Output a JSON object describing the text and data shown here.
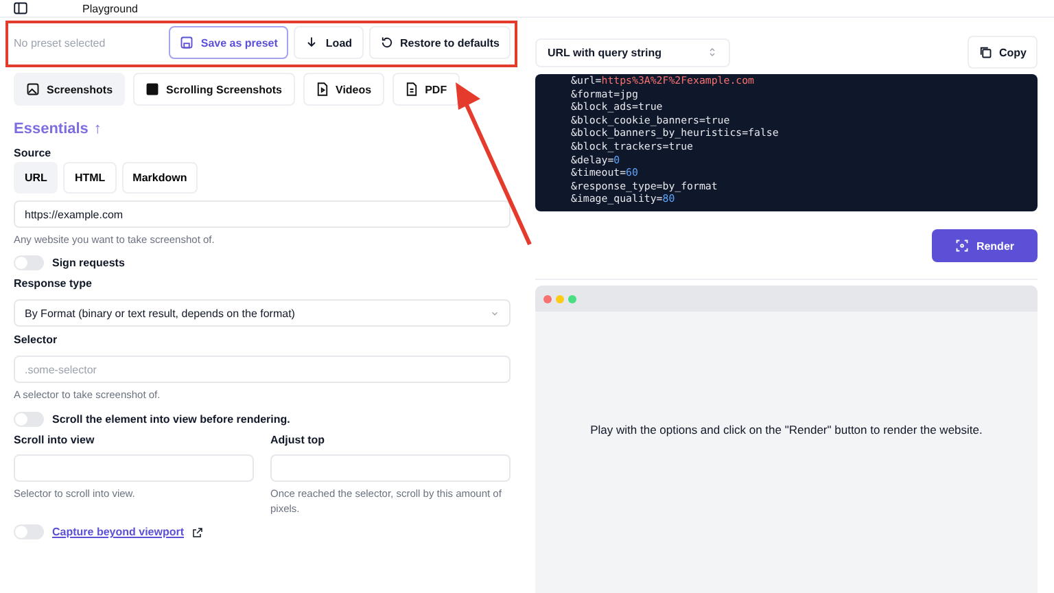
{
  "header": {
    "title": "Playground"
  },
  "preset_bar": {
    "status": "No preset selected",
    "buttons": [
      {
        "label": "Save as preset",
        "kind": "primary"
      },
      {
        "label": "Load",
        "kind": "plain"
      },
      {
        "label": "Restore to defaults",
        "kind": "plain"
      }
    ]
  },
  "tabs": [
    {
      "label": "Screenshots",
      "selected": true
    },
    {
      "label": "Scrolling Screenshots",
      "selected": false
    },
    {
      "label": "Videos",
      "selected": false
    },
    {
      "label": "PDF",
      "selected": false
    }
  ],
  "section": {
    "title": "Essentials",
    "toggle": "↑"
  },
  "source": {
    "label": "Source",
    "options": [
      {
        "label": "URL",
        "selected": true
      },
      {
        "label": "HTML",
        "selected": false
      },
      {
        "label": "Markdown",
        "selected": false
      }
    ],
    "value": "https://example.com",
    "hint": "Any website you want to take screenshot of."
  },
  "sign_requests": {
    "label": "Sign requests",
    "on": false
  },
  "response_type": {
    "label": "Response type",
    "value": "By Format (binary or text result, depends on the format)"
  },
  "selector": {
    "label": "Selector",
    "placeholder": ".some-selector",
    "hint": "A selector to take screenshot of."
  },
  "scroll_toggle": {
    "label": "Scroll the element into view before rendering.",
    "on": false
  },
  "scroll_fields": [
    {
      "label": "Scroll into view",
      "hint": "Selector to scroll into view."
    },
    {
      "label": "Adjust top",
      "hint": "Once reached the selector, scroll by this amount of pixels."
    }
  ],
  "capture": {
    "label": "Capture beyond viewport",
    "on": false
  },
  "output": {
    "format": "URL with query string",
    "copy": "Copy",
    "render": "Render"
  },
  "code_lines": [
    {
      "key": "&url=",
      "value": "https%3A%2F%2Fexample.com",
      "kind": "key"
    },
    {
      "key": "&format=",
      "value": "jpg",
      "kind": "plain"
    },
    {
      "key": "&block_ads=",
      "value": "true",
      "kind": "plain"
    },
    {
      "key": "&block_cookie_banners=",
      "value": "true",
      "kind": "plain"
    },
    {
      "key": "&block_banners_by_heuristics=",
      "value": "false",
      "kind": "plain"
    },
    {
      "key": "&block_trackers=",
      "value": "true",
      "kind": "plain"
    },
    {
      "key": "&delay=",
      "value": "0",
      "kind": "number"
    },
    {
      "key": "&timeout=",
      "value": "60",
      "kind": "number"
    },
    {
      "key": "&response_type=",
      "value": "by_format",
      "kind": "plain"
    },
    {
      "key": "&image_quality=",
      "value": "80",
      "kind": "number"
    }
  ],
  "preview": {
    "message": "Play with the options and click on the \"Render\" button to render the website."
  }
}
